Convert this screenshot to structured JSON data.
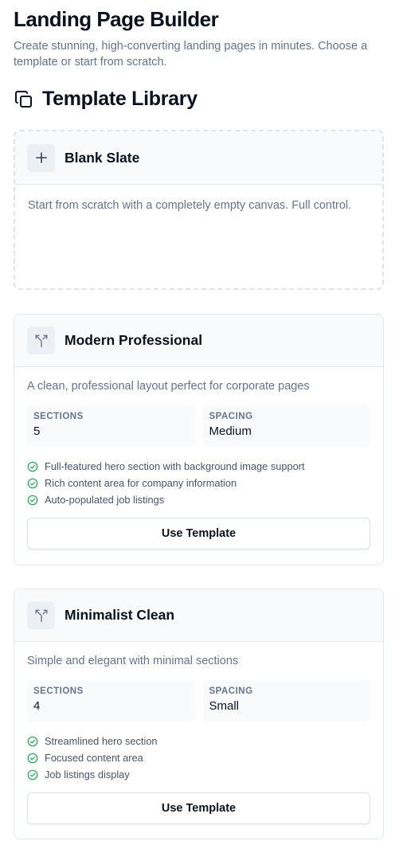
{
  "page": {
    "title": "Landing Page Builder",
    "subtitle": "Create stunning, high-converting landing pages in minutes. Choose a template or start from scratch."
  },
  "library": {
    "title": "Template Library",
    "icon": "copy-icon"
  },
  "blank": {
    "title": "Blank Slate",
    "description": "Start from scratch with a completely empty canvas. Full control.",
    "icon": "plus-icon"
  },
  "templates": [
    {
      "title": "Modern Professional",
      "description": "A clean, professional layout perfect for corporate pages",
      "icon": "split-arrow-icon",
      "sections_label": "SECTIONS",
      "sections_value": "5",
      "spacing_label": "SPACING",
      "spacing_value": "Medium",
      "features": [
        "Full-featured hero section with background image support",
        "Rich content area for company information",
        "Auto-populated job listings"
      ],
      "button_label": "Use Template"
    },
    {
      "title": "Minimalist Clean",
      "description": "Simple and elegant with minimal sections",
      "icon": "split-arrow-icon",
      "sections_label": "SECTIONS",
      "sections_value": "4",
      "spacing_label": "SPACING",
      "spacing_value": "Small",
      "features": [
        "Streamlined hero section",
        "Focused content area",
        "Job listings display"
      ],
      "button_label": "Use Template"
    }
  ],
  "colors": {
    "check": "#22a55b",
    "muted_text": "#64748b",
    "border": "#e2e8f0"
  }
}
